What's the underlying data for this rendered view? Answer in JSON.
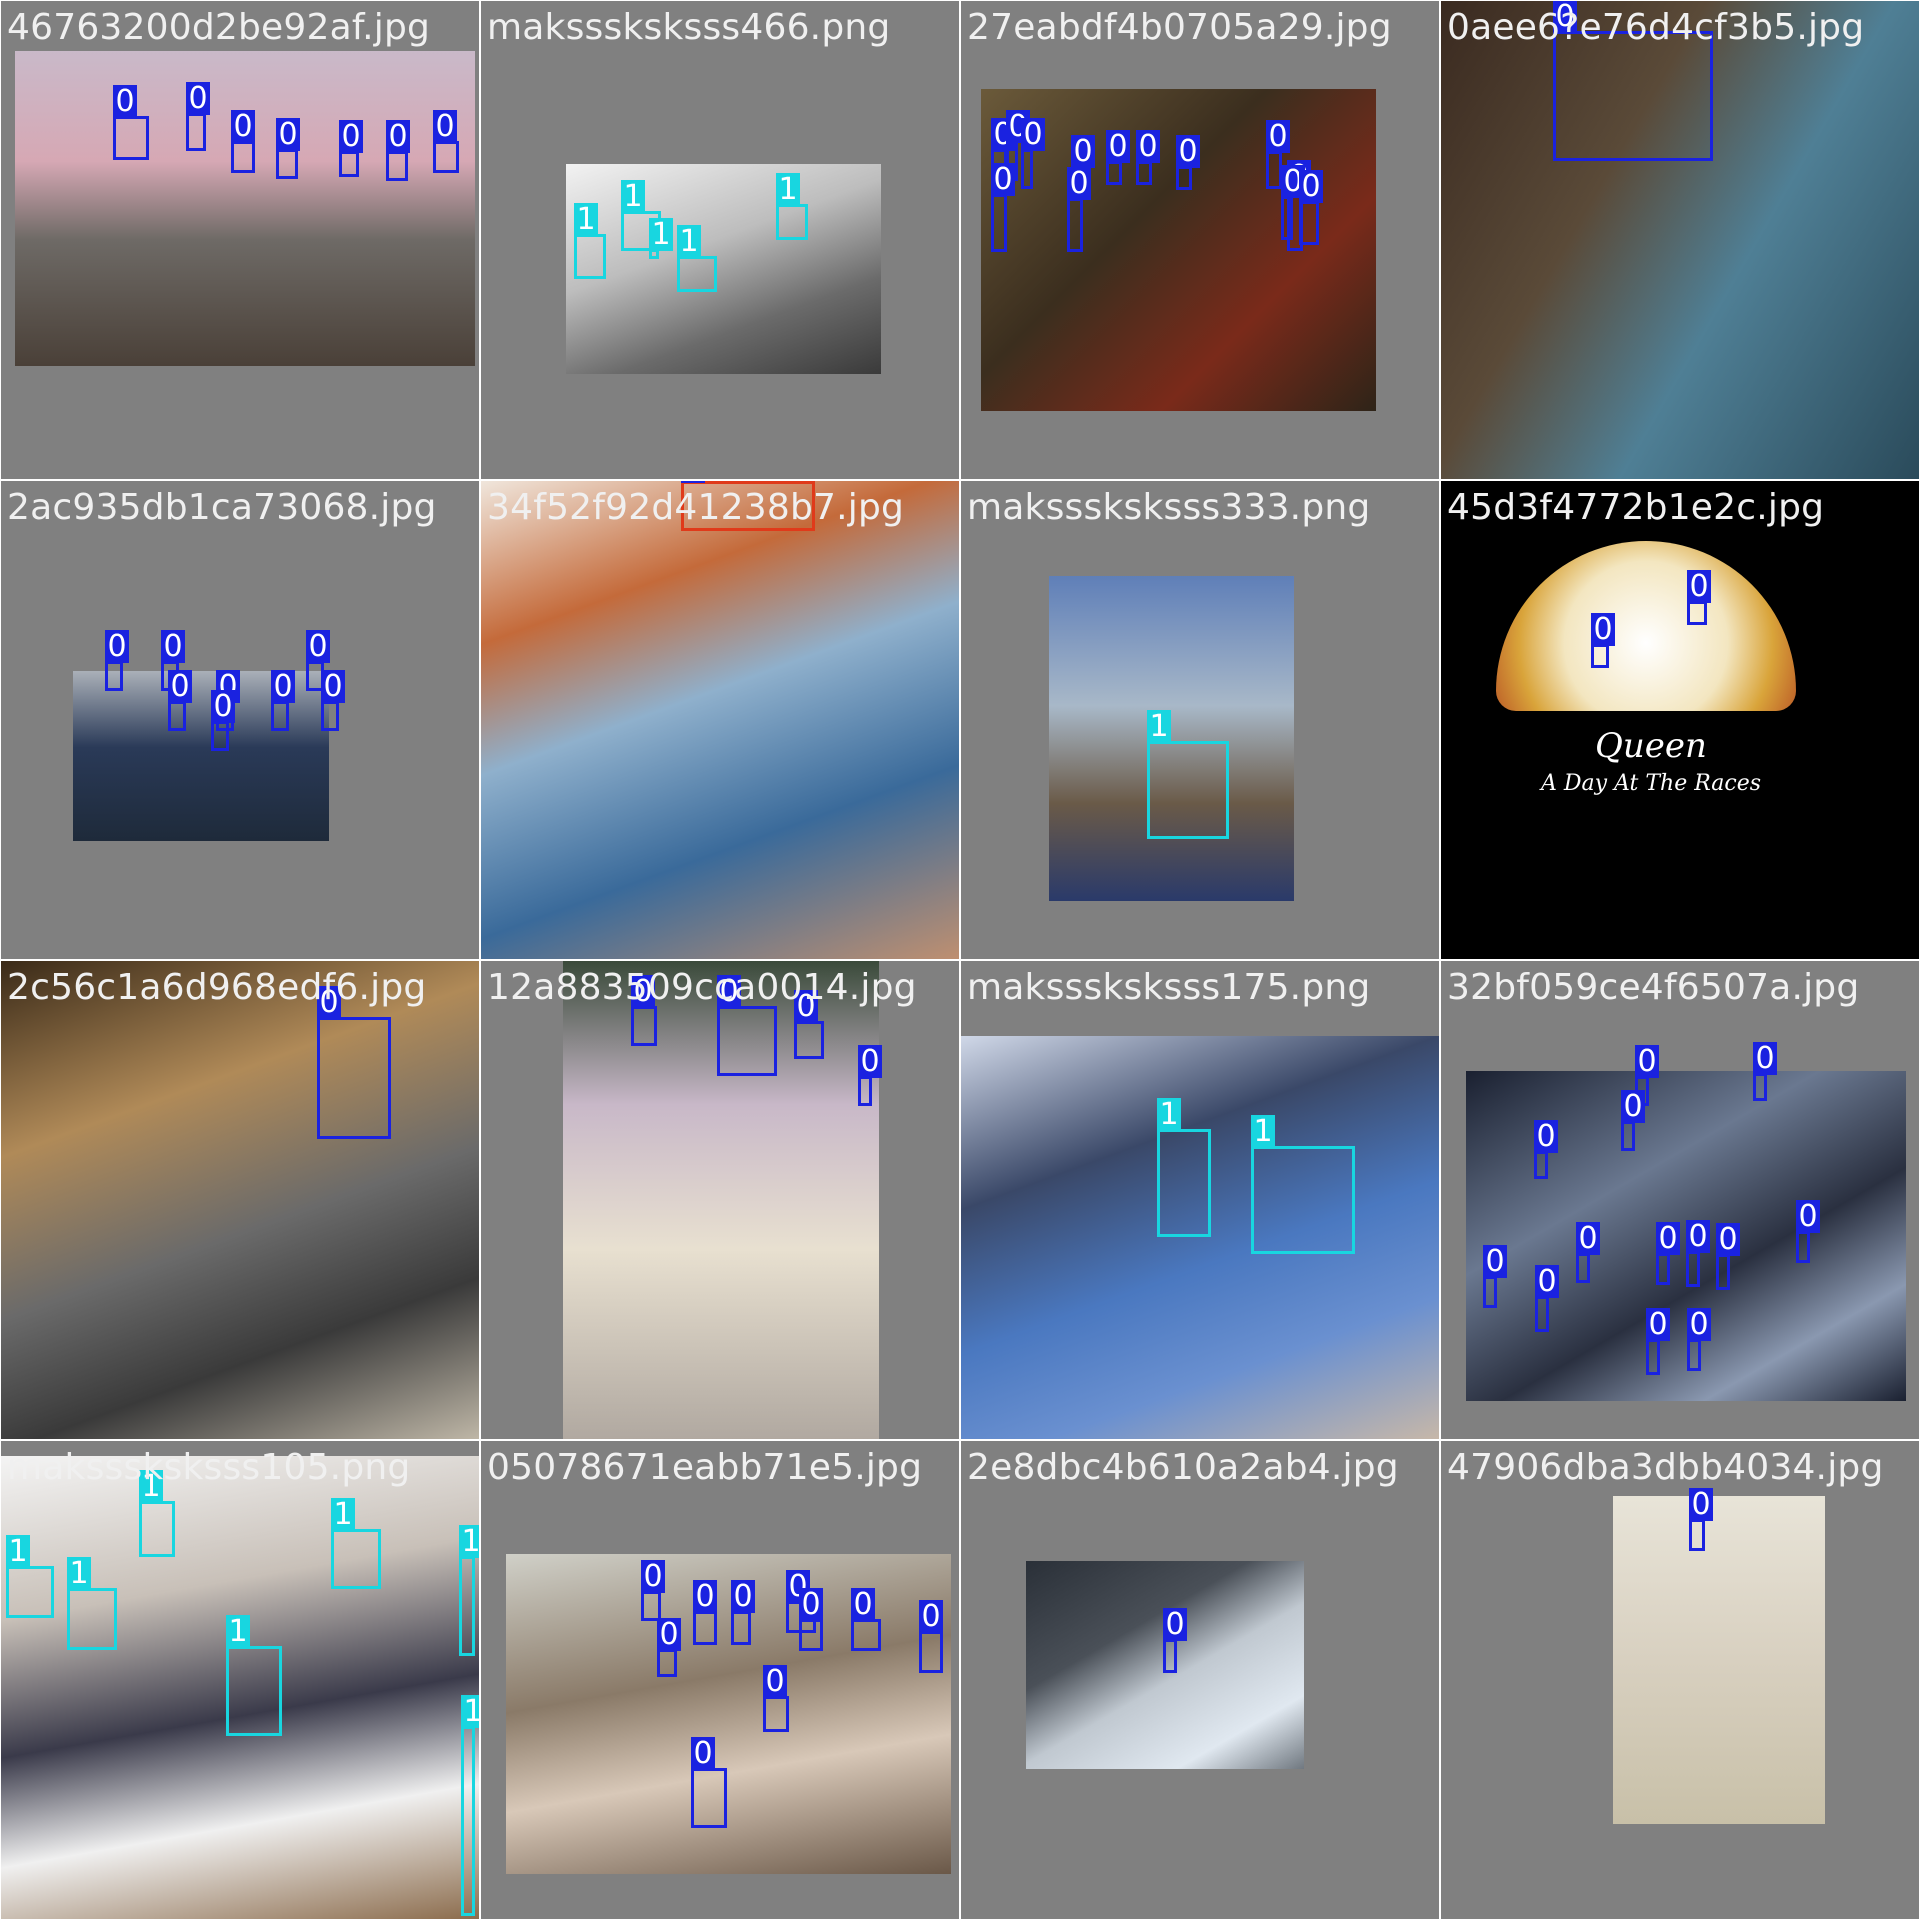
{
  "grid": {
    "tiles": [
      {
        "title": "46763200d2be92af.jpg",
        "labels": [
          "0",
          "0",
          "0",
          "0",
          "0",
          "0",
          "0"
        ]
      },
      {
        "title": "maksssksksss466.png",
        "labels": [
          "1",
          "1",
          "1",
          "1",
          "1"
        ]
      },
      {
        "title": "27eabdf4b0705a29.jpg",
        "labels": [
          "0",
          "0",
          "0",
          "0",
          "0",
          "0",
          "0",
          "0",
          "0",
          "0",
          "0",
          "0",
          "0"
        ]
      },
      {
        "title": "0aee6?e76d4cf3b5.jpg",
        "labels": [
          "0"
        ]
      },
      {
        "title": "2ac935db1ca73068.jpg",
        "labels": [
          "0",
          "0",
          "0",
          "0",
          "0",
          "0",
          "0",
          "0"
        ]
      },
      {
        "title": "34f52f92d41238b7.jpg",
        "labels": [
          "0"
        ]
      },
      {
        "title": "maksssksksss333.png",
        "labels": [
          "1"
        ]
      },
      {
        "title": "45d3f4772b1e2c.jpg",
        "labels": [
          "0",
          "0"
        ],
        "album_text": [
          "Queen",
          "A Day At The Races"
        ]
      },
      {
        "title": "2c56c1a6d968edf6.jpg",
        "labels": [
          "0"
        ]
      },
      {
        "title": "12a883509cca0014.jpg",
        "labels": [
          "0",
          "0",
          "0",
          "0"
        ]
      },
      {
        "title": "maksssksksss175.png",
        "labels": [
          "1",
          "1"
        ]
      },
      {
        "title": "32bf059ce4f6507a.jpg",
        "labels": [
          "0",
          "0",
          "0",
          "0",
          "0",
          "0",
          "0",
          "0",
          "0",
          "0",
          "0",
          "0",
          "0"
        ]
      },
      {
        "title": "maksssksksss105.png",
        "labels": [
          "1",
          "1",
          "1",
          "1",
          "1",
          "1",
          "1"
        ]
      },
      {
        "title": "05078671eabb71e5.jpg",
        "labels": [
          "0",
          "0",
          "0",
          "0",
          "0",
          "0",
          "0",
          "0",
          "0",
          "0"
        ]
      },
      {
        "title": "2e8dbc4b610a2ab4.jpg",
        "labels": [
          "0"
        ]
      },
      {
        "title": "47906dba3dbb4034.jpg",
        "labels": [
          "0"
        ]
      }
    ]
  },
  "colors": {
    "class_0": "#1a22e0",
    "class_1": "#18d6e0",
    "tile_bg": "#808080",
    "title_text": "#f0f0f0"
  }
}
